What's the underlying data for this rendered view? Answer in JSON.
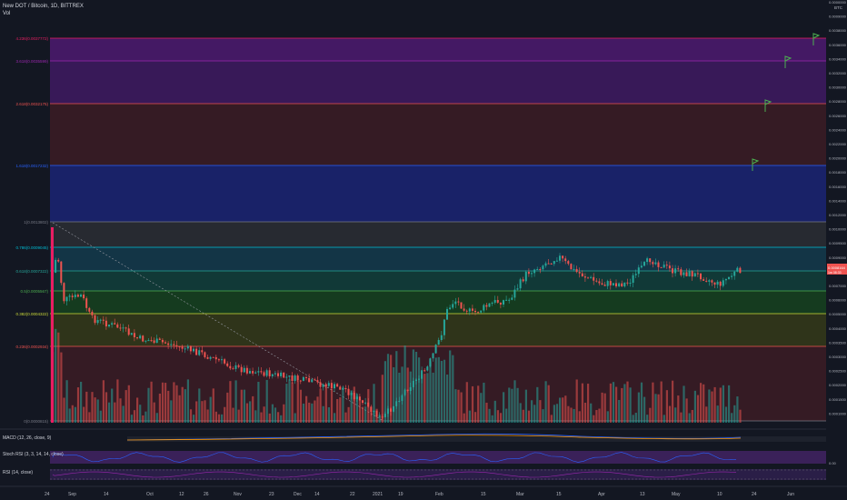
{
  "header": {
    "symbol_line": "New DOT / Bitcoin, 1D, BITTREX",
    "volume_label": "Vol",
    "currency": "BTC"
  },
  "colors": {
    "background": "#131722",
    "up": "#26a69a",
    "down": "#ef5350",
    "fib_1_2618": "#ef5350",
    "fib_2_618": "#9c27b0",
    "fib_3_618": "#9c27b0",
    "fib_1_618": "#2962ff",
    "fib_1": "#787b86",
    "fib_0786": "#00bcd4",
    "fib_0618": "#26a69a",
    "fib_05": "#4caf50",
    "fib_0382": "#cddc39",
    "fib_0236": "#ef5350"
  },
  "fib_levels": [
    {
      "label": "4.236(0.0037772)",
      "price": 0.0037772,
      "color": "#e91e63",
      "fill": "#4a1a6b"
    },
    {
      "label": "3.618(0.0035599)",
      "price": 0.0035599,
      "color": "#9c27b0",
      "fill": "#3d1a5e"
    },
    {
      "label": "2.618(0.0032175)",
      "price": 0.0032175,
      "color": "#ef5350",
      "fill": "#3a1c25"
    },
    {
      "label": "1.618(0.0017232)",
      "price": 0.0017232,
      "color": "#2962ff",
      "fill": "#1b2470"
    },
    {
      "label": "1(0.0013802)",
      "price": 0.0013802,
      "color": "#787b86",
      "fill": "#2a2c33"
    },
    {
      "label": "0.786(0.0009045)",
      "price": 0.0009045,
      "color": "#00bcd4",
      "fill": "#14384a"
    },
    {
      "label": "0.618(0.0007322)",
      "price": 0.0007322,
      "color": "#26a69a",
      "fill": "#123d3a"
    },
    {
      "label": "0.5(0.0005567)",
      "price": 0.0005567,
      "color": "#4caf50",
      "fill": "#163f1f"
    },
    {
      "label": "0.382(0.0004322)",
      "price": 0.0004322,
      "color": "#cddc39",
      "fill": "#33371a"
    },
    {
      "label": "0.236(0.0002934)",
      "price": 0.0002934,
      "color": "#ef5350",
      "fill": "#3a1c25"
    },
    {
      "label": "0(0.0000815)",
      "price": 8.15e-05,
      "color": "#787b86",
      "fill": ""
    }
  ],
  "price_axis": {
    "ticks": [
      "0.0000000",
      "0.0009000",
      "0.0038000",
      "0.0036000",
      "0.0034000",
      "0.0032000",
      "0.0030000",
      "0.0028000",
      "0.0026000",
      "0.0024000",
      "0.0022000",
      "0.0020000",
      "0.0018000",
      "0.0016000",
      "0.0014000",
      "0.0012000",
      "0.0010000",
      "0.0009500",
      "0.0009000",
      "0.0008000",
      "0.0007000",
      "0.0006000",
      "0.0005000",
      "0.0004000",
      "0.0003500",
      "0.0003000",
      "0.0002500",
      "0.0002000",
      "0.0001500",
      "0.0001000"
    ],
    "current_price": "0.0008164",
    "current_sub": "1m 08:33"
  },
  "time_axis": {
    "labels": [
      "24",
      "Sep",
      "14",
      "Oct",
      "12",
      "26",
      "Nov",
      "23",
      "Dec",
      "14",
      "22",
      "2021",
      "19",
      "Feb",
      "15",
      "Mar",
      "15",
      "Apr",
      "13",
      "May",
      "10",
      "24",
      "Jun"
    ]
  },
  "indicators": {
    "macd": "MACD (12, 26, close, 9)",
    "stoch": "Stoch RSI (3, 3, 14, 14, close)",
    "stoch_value": "0.00",
    "rsi": "RSI (14, close)"
  }
}
